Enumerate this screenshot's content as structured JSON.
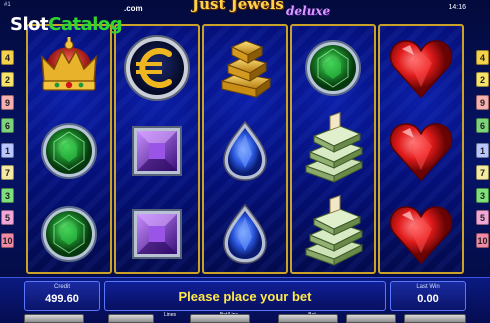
{
  "header": {
    "machine_id": "#1",
    "clock": "14:16",
    "watermark": {
      "slot": "Slot",
      "catalog": "Catalog",
      "com": ".com"
    },
    "title": "Just Jewels",
    "subtitle": "deluxe"
  },
  "line_markers": {
    "left": [
      "4",
      "2",
      "9",
      "6",
      "1",
      "7",
      "3",
      "5",
      "10"
    ],
    "right": [
      "4",
      "2",
      "9",
      "6",
      "1",
      "7",
      "3",
      "5",
      "10"
    ],
    "colors": {
      "1": "#b9c6ff",
      "2": "#f7e26a",
      "3": "#7ee07a",
      "4": "#f5d04a",
      "5": "#f2a6d8",
      "6": "#7bd37b",
      "7": "#f6e9a0",
      "9": "#f7b0b0",
      "10": "#f08aa6"
    }
  },
  "reels": [
    [
      "crown-icon",
      "emerald-icon",
      "emerald-icon"
    ],
    [
      "euro-coin-icon",
      "amethyst-icon",
      "amethyst-icon"
    ],
    [
      "gold-bars-icon",
      "sapphire-icon",
      "sapphire-icon"
    ],
    [
      "emerald-icon",
      "money-stack-icon",
      "money-stack-icon"
    ],
    [
      "ruby-heart-icon",
      "ruby-heart-icon",
      "ruby-heart-icon"
    ]
  ],
  "panel": {
    "credit_label": "Credit",
    "credit_value": "499.60",
    "message": "Please place your bet",
    "last_win_label": "Last Win",
    "last_win_value": "0.00",
    "lines_label": "Lines",
    "bet_line_label": "Bet/Line",
    "bet_label": "Bet"
  }
}
